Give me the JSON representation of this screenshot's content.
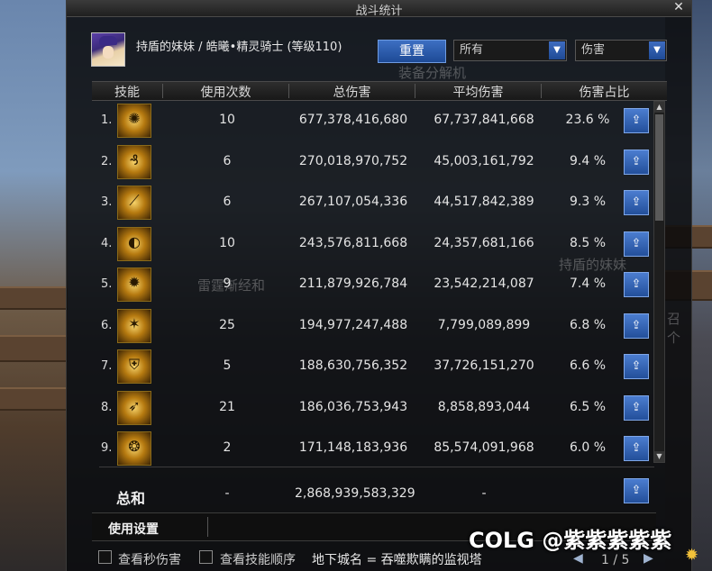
{
  "window": {
    "title": "战斗统计",
    "close_glyph": "✕"
  },
  "character": {
    "name": "持盾的妹妹 / 皓曦•精灵骑士 (等级110)"
  },
  "toolbar": {
    "reset_label": "重置",
    "filter_select": {
      "value": "所有"
    },
    "metric_select": {
      "value": "伤害"
    },
    "dropdown_glyph": "▼"
  },
  "background": {
    "texts": [
      "装备分解机",
      "雷霆渐经和",
      "持盾的妹妹",
      "召个"
    ]
  },
  "table": {
    "headers": [
      "技能",
      "使用次数",
      "总伤害",
      "平均伤害",
      "伤害占比"
    ],
    "share_glyph": "⇪",
    "rows": [
      {
        "rank": "1.",
        "icon": "skill-shield-burst-icon",
        "glyph": "✺",
        "uses": "10",
        "total": "677,378,416,680",
        "avg": "67,737,841,668",
        "pct": "23.6 %"
      },
      {
        "rank": "2.",
        "icon": "skill-flame-swirl-icon",
        "glyph": "₰",
        "uses": "6",
        "total": "270,018,970,752",
        "avg": "45,003,161,792",
        "pct": "9.4 %"
      },
      {
        "rank": "3.",
        "icon": "skill-lance-strike-icon",
        "glyph": "⟋",
        "uses": "6",
        "total": "267,107,054,336",
        "avg": "44,517,842,389",
        "pct": "9.3 %"
      },
      {
        "rank": "4.",
        "icon": "skill-shield-wave-icon",
        "glyph": "◐",
        "uses": "10",
        "total": "243,576,811,668",
        "avg": "24,357,681,166",
        "pct": "8.5 %"
      },
      {
        "rank": "5.",
        "icon": "skill-sun-slash-icon",
        "glyph": "✹",
        "uses": "9",
        "total": "211,879,926,784",
        "avg": "23,542,214,087",
        "pct": "7.4 %"
      },
      {
        "rank": "6.",
        "icon": "skill-radiant-cross-icon",
        "glyph": "✶",
        "uses": "25",
        "total": "194,977,247,488",
        "avg": "7,799,089,899",
        "pct": "6.8 %"
      },
      {
        "rank": "7.",
        "icon": "skill-shield-guard-icon",
        "glyph": "⛨",
        "uses": "5",
        "total": "188,630,756,352",
        "avg": "37,726,151,270",
        "pct": "6.6 %"
      },
      {
        "rank": "8.",
        "icon": "skill-sword-thrust-icon",
        "glyph": "➶",
        "uses": "21",
        "total": "186,036,753,943",
        "avg": "8,858,893,044",
        "pct": "6.5 %"
      },
      {
        "rank": "9.",
        "icon": "skill-dragon-rush-icon",
        "glyph": "❂",
        "uses": "2",
        "total": "171,148,183,936",
        "avg": "85,574,091,968",
        "pct": "6.0 %"
      }
    ],
    "scroll_up": "▲",
    "scroll_down": "▼"
  },
  "summary": {
    "label": "总和",
    "uses": "-",
    "total": "2,868,939,583,329",
    "avg": "-"
  },
  "settings": {
    "label": "使用设置"
  },
  "options": {
    "per_second": "查看秒伤害",
    "skill_order": "查看技能顺序",
    "dungeon": "地下城名 = 吞噬欺瞒的监视塔"
  },
  "pager": {
    "text": "1 / 5",
    "prev": "◀",
    "next": "▶"
  },
  "watermark": {
    "text": "COLG @紫紫紫紫紫"
  },
  "gear_glyph": "✹"
}
